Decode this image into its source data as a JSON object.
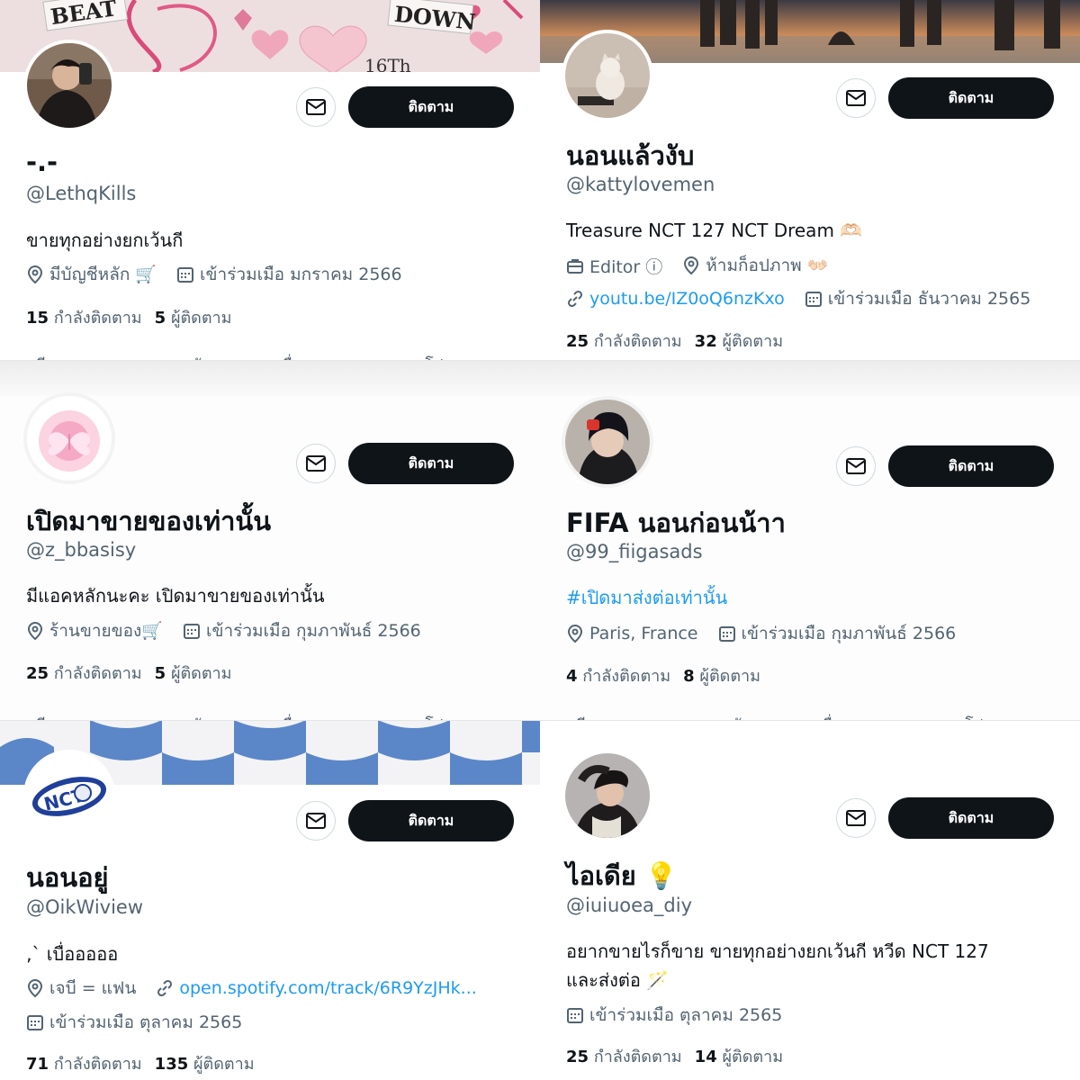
{
  "profiles": [
    {
      "name": "-.-",
      "handle": "@LethqKills",
      "bio": "ขายทุกอย่างยกเว้นกี",
      "location": "มีบัญชีหลัก 🛒",
      "joined": "เข้าร่วมเมือ มกราคม 2566",
      "following_count": "15",
      "following_label": "กำลังติดตาม",
      "followers_count": "5",
      "followers_label": "ผู้ติดตาม",
      "follow_label": "ติดตาม",
      "banner_text_1": "BEAT",
      "banner_text_2": "DOWN",
      "banner_text_3": "16Th"
    },
    {
      "name": "นอนแล้วงับ",
      "handle": "@kattylovemen",
      "bio": "Treasure NCT 127 NCT Dream 🫶🏻",
      "profession": "Editor ⓘ",
      "location": "ห้ามก็อปภาพ 👐🏻",
      "website": "youtu.be/IZ0oQ6nzKxo",
      "joined": "เข้าร่วมเมือ ธันวาคม 2565",
      "following_count": "25",
      "following_label": "กำลังติดตาม",
      "followers_count": "32",
      "followers_label": "ผู้ติดตาม",
      "follow_label": "ติดตาม"
    },
    {
      "name": "เปิดมาขายของเท่านั้น",
      "handle": "@z_bbasisy",
      "bio": "มีแอคหลักนะคะ เปิดมาขายของเท่านั้น",
      "location": "ร้านขายของ🛒",
      "joined": "เข้าร่วมเมือ กุมภาพันธ์ 2566",
      "following_count": "25",
      "following_label": "กำลังติดตาม",
      "followers_count": "5",
      "followers_label": "ผู้ติดตาม",
      "follow_label": "ติดตาม"
    },
    {
      "name": "FIFA นอนก่อนน้าา",
      "handle": "@99_fiigasads",
      "bio": "#เปิดมาส่งต่อเท่านั้น",
      "location": "Paris, France",
      "joined": "เข้าร่วมเมือ กุมภาพันธ์ 2566",
      "following_count": "4",
      "following_label": "กำลังติดตาม",
      "followers_count": "8",
      "followers_label": "ผู้ติดตาม",
      "follow_label": "ติดตาม"
    },
    {
      "name": "นอนอยู่",
      "handle": "@OikWiview",
      "bio": "‚` เบื่อออออ",
      "location": "เจบี = แฟน",
      "website": "open.spotify.com/track/6R9YzJHk...",
      "joined": "เข้าร่วมเมือ ตุลาคม 2565",
      "following_count": "71",
      "following_label": "กำลังติดตาม",
      "followers_count": "135",
      "followers_label": "ผู้ติดตาม",
      "follow_label": "ติดตาม",
      "logo_text": "NCT"
    },
    {
      "name": "ไอเดีย 💡",
      "handle": "@iuiuoea_diy",
      "bio_line1": "อยากขายไรก็ขาย ขายทุกอย่างยกเว้นกี หวีด NCT 127",
      "bio_line2": "และส่งต่อ 🪄",
      "joined": "เข้าร่วมเมือ ตุลาคม 2565",
      "following_count": "25",
      "following_label": "กำลังติดตาม",
      "followers_count": "14",
      "followers_label": "ผู้ติดตาม",
      "follow_label": "ติดตาม"
    }
  ],
  "tabs": [
    "ทวีต",
    "การตอบกลับ",
    "สื่อ",
    "รายการโปรด"
  ],
  "colors": {
    "link": "#1d9bf0",
    "text_primary": "#0f1419",
    "text_secondary": "#536471",
    "button_dark": "#0f1419",
    "checker_blue": "#5b87c9",
    "banner_pink": "#f1d7d9"
  }
}
